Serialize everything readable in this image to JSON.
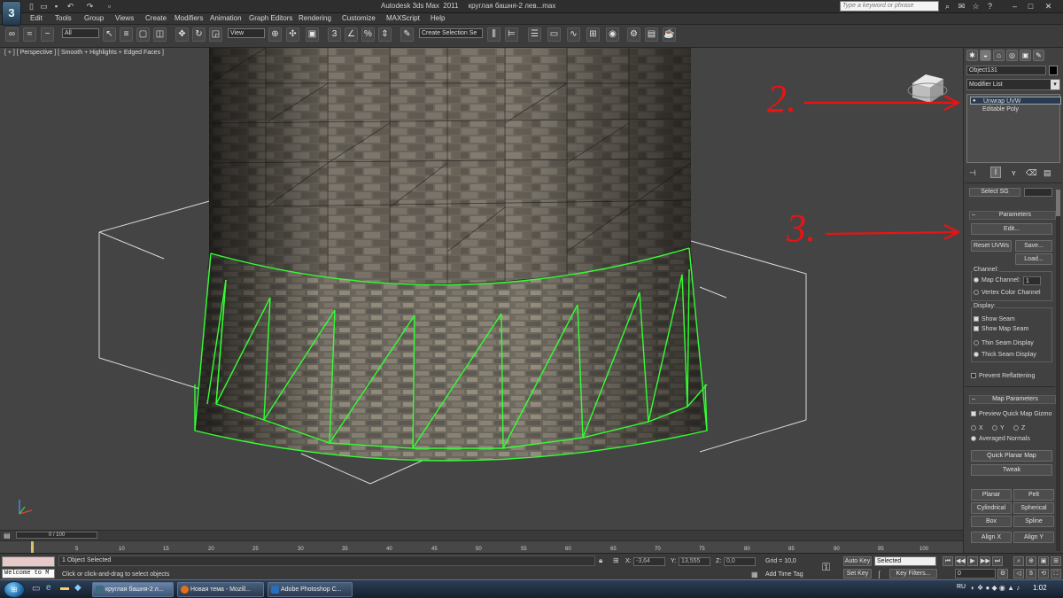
{
  "titlebar": {
    "title": "Autodesk 3ds Max  2011     круглая башня-2 лев...max",
    "search_placeholder": "Type a keyword or phrase",
    "logo_text": "3"
  },
  "menubar": {
    "items": [
      "Edit",
      "Tools",
      "Group",
      "Views",
      "Create",
      "Modifiers",
      "Animation",
      "Graph Editors",
      "Rendering",
      "Customize",
      "MAXScript",
      "Help"
    ]
  },
  "toolbar": {
    "filter_select": "All",
    "refcoord_select": "View",
    "selection_set": "Create Selection Se"
  },
  "viewport": {
    "label": "[ + ] [ Perspective ] [ Smooth + Highlights + Edged Faces ]",
    "annotation_2": "2.",
    "annotation_3": "3.",
    "selection_color": "#33ff33",
    "annotation_color": "#e81414"
  },
  "command_panel": {
    "object_name": "Object131",
    "modifier_list": "Modifier List",
    "stack": [
      "Unwrap UVW",
      "Editable Poly"
    ],
    "select_sg_label": "Select SG",
    "parameters": {
      "title": "Parameters",
      "edit_button": "Edit...",
      "reset_button": "Reset UVWs",
      "save_button": "Save...",
      "load_button": "Load...",
      "channel_group": "Channel:",
      "map_channel_label": "Map Channel:",
      "map_channel_value": "1",
      "vertex_color_channel": "Vertex Color Channel",
      "display_group": "Display:",
      "show_seam": "Show Seam",
      "show_map_seam": "Show Map Seam",
      "thin_seam": "Thin Seam Display",
      "thick_seam": "Thick Seam Display",
      "prevent_reflattening": "Prevent Reflattening"
    },
    "map_parameters": {
      "title": "Map Parameters",
      "preview_gizmo": "Preview Quick Map Gizmo",
      "axis_x": "X",
      "axis_y": "Y",
      "axis_z": "Z",
      "averaged_normals": "Averaged Normals",
      "quick_planar_map": "Quick Planar Map",
      "tweak": "Tweak",
      "planar": "Planar",
      "pelt": "Pelt",
      "cylindrical": "Cylindrical",
      "spherical": "Spherical",
      "box": "Box",
      "spline": "Spline",
      "align_x": "Align X",
      "align_y": "Align Y"
    }
  },
  "timeline": {
    "slider": "0 / 100",
    "ticks": [
      "0",
      "5",
      "10",
      "15",
      "20",
      "25",
      "30",
      "35",
      "40",
      "45",
      "50",
      "55",
      "60",
      "65",
      "70",
      "75",
      "80",
      "85",
      "90",
      "95",
      "100"
    ]
  },
  "status": {
    "listener_text": "Welcome to M",
    "selected_text": "1 Object Selected",
    "prompt_text": "Click or click-and-drag to select objects",
    "x_label": "X:",
    "x_value": "-3,64",
    "y_label": "Y:",
    "y_value": "13,555",
    "z_label": "Z:",
    "z_value": "0,0",
    "grid": "Grid = 10,0",
    "add_time_tag": "Add Time Tag",
    "auto_key": "Auto Key",
    "auto_key_select": "Selected",
    "set_key": "Set Key",
    "key_filters": "Key Filters...",
    "frame_value": "0"
  },
  "taskbar": {
    "tasks": [
      "круглая башня-2 л...",
      "Новая тема - Mozill...",
      "Adobe Photoshop C..."
    ],
    "lang": "RU",
    "time": "1:02"
  }
}
